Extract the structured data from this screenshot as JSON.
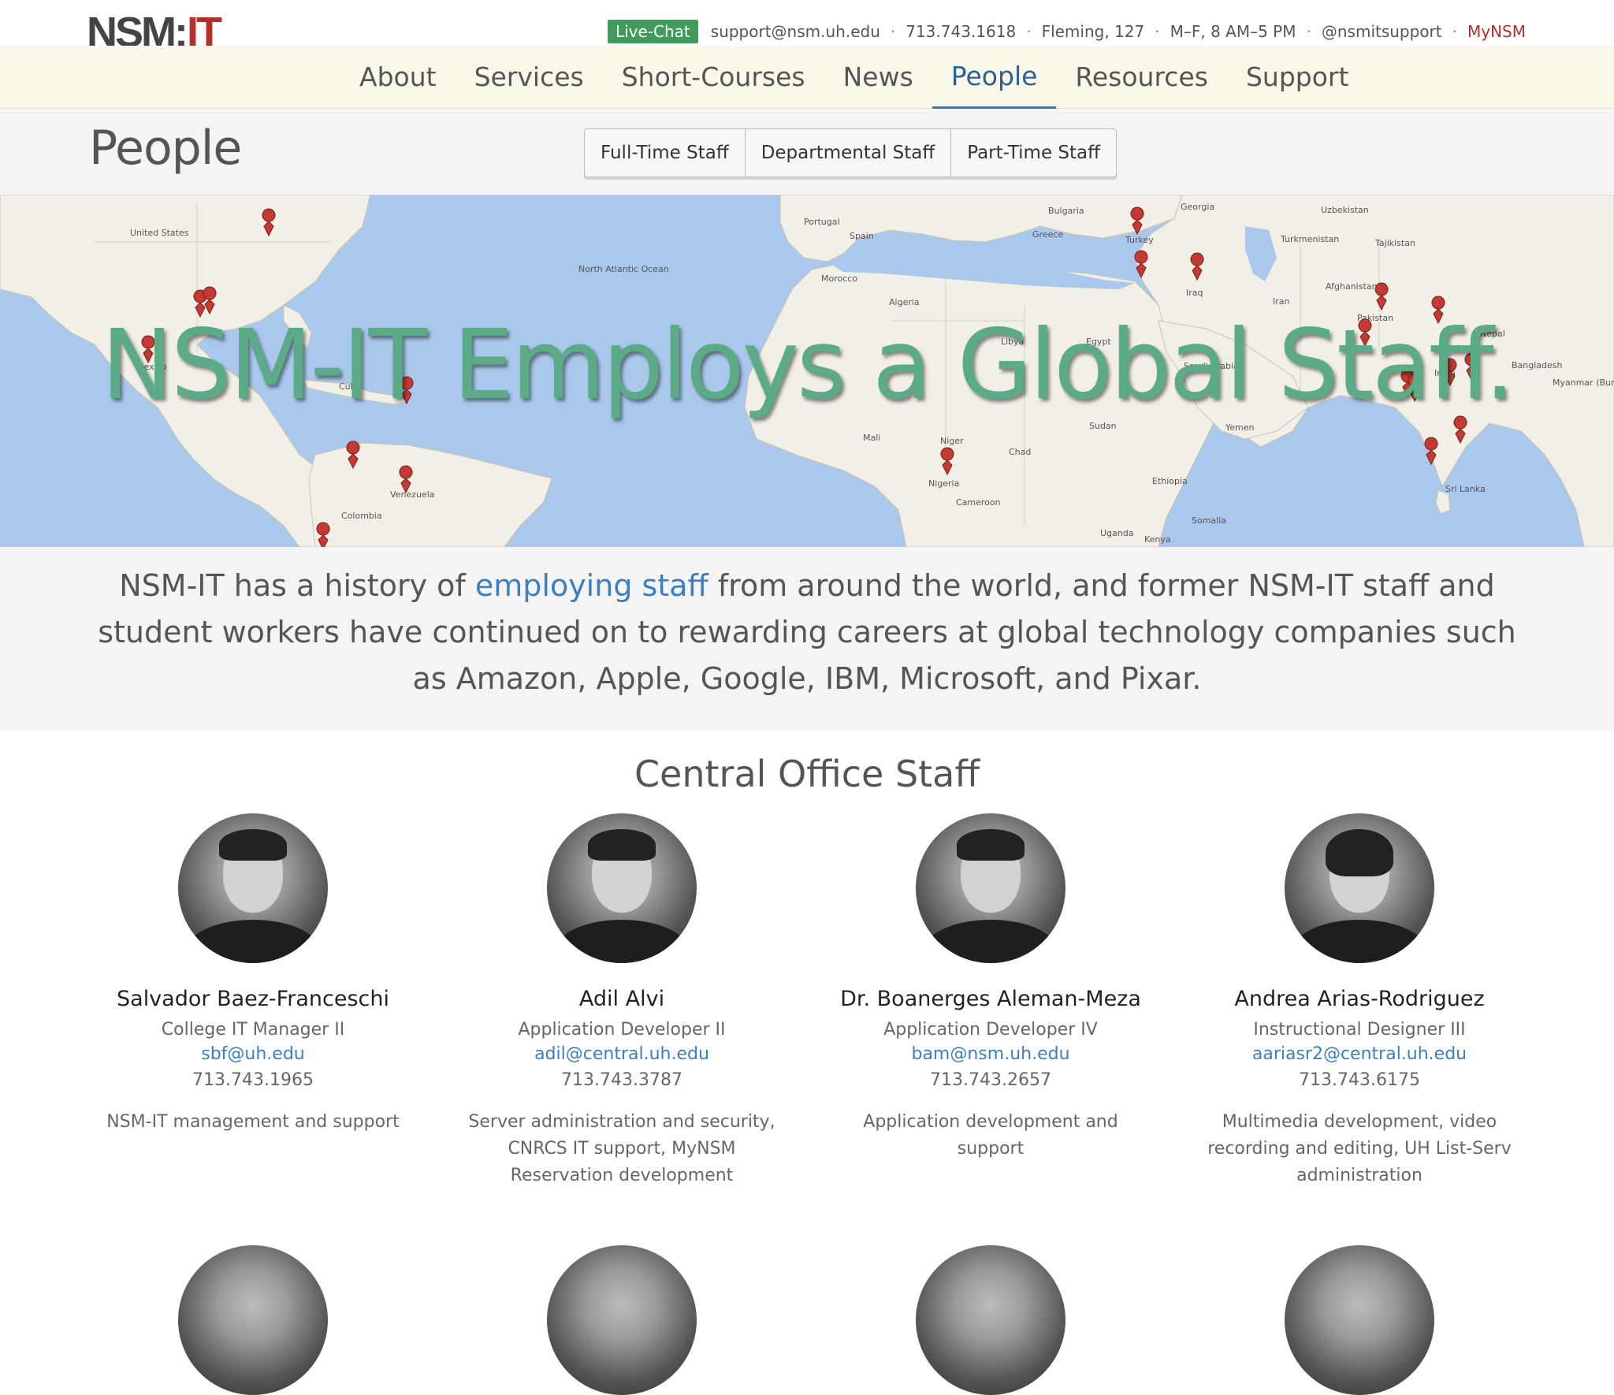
{
  "brand": {
    "logo_a": "NSM",
    "logo_colon": ":",
    "logo_b": "IT"
  },
  "utility": {
    "chat": "Live-Chat",
    "email": "support@nsm.uh.edu",
    "phone": "713.743.1618",
    "location": "Fleming, 127",
    "hours": "M–F, 8 AM–5 PM",
    "twitter": "@nsmitsupport",
    "mynsm": "MyNSM",
    "separator": "·"
  },
  "nav": [
    "About",
    "Services",
    "Short-Courses",
    "News",
    "People",
    "Resources",
    "Support"
  ],
  "nav_active": "People",
  "page": {
    "title": "People",
    "buttons": [
      "Full-Time Staff",
      "Departmental Staff",
      "Part-Time Staff"
    ]
  },
  "hero": {
    "headline": "NSM-IT Employs a Global Staff.",
    "map_labels": [
      "United States",
      "Mexico",
      "Colombia",
      "Venezuela",
      "Cuba",
      "Morocco",
      "Algeria",
      "Mali",
      "Niger",
      "Chad",
      "Nigeria",
      "Sudan",
      "Egypt",
      "Saudi Arabia",
      "Turkey",
      "Iraq",
      "Iran",
      "Afghanistan",
      "Pakistan",
      "Spain",
      "Portugal",
      "Greece",
      "Bulgaria",
      "Georgia",
      "Turkmenistan",
      "Uzbekistan",
      "Tajikistan",
      "Nepal",
      "Bangladesh",
      "Sri Lanka",
      "Ethiopia",
      "Somalia",
      "Yemen",
      "Kenya",
      "Uganda",
      "Cameroon",
      "India",
      "Myanmar (Burma)",
      "Libya",
      "North Atlantic Ocean"
    ],
    "map_colors": {
      "water": "#a9c8ec",
      "land": "#f2efe6",
      "marker": "#c23a31"
    }
  },
  "intro": {
    "before_link": "NSM-IT has a history of ",
    "link": "employing staff",
    "after_link": " from around the world, and former NSM-IT staff and student workers have continued on to rewarding careers at global technology companies such as Amazon, Apple, Google, IBM, Microsoft, and Pixar."
  },
  "section_title": "Central Office Staff",
  "staff": [
    {
      "name": "Salvador Baez-Franceschi",
      "title": "College IT Manager II",
      "email": "sbf@uh.edu",
      "phone": "713.743.1965",
      "duties": "NSM-IT management and support"
    },
    {
      "name": "Adil Alvi",
      "title": "Application Developer II",
      "email": "adil@central.uh.edu",
      "phone": "713.743.3787",
      "duties": "Server administration and security, CNRCS IT support, MyNSM Reservation development"
    },
    {
      "name": "Dr. Boanerges Aleman-Meza",
      "title": "Application Developer IV",
      "email": "bam@nsm.uh.edu",
      "phone": "713.743.2657",
      "duties": "Application development and support"
    },
    {
      "name": "Andrea Arias-Rodriguez",
      "title": "Instructional Designer III",
      "email": "aariasr2@central.uh.edu",
      "phone": "713.743.6175",
      "duties": "Multimedia development, video recording and editing, UH List-Serv administration"
    }
  ]
}
